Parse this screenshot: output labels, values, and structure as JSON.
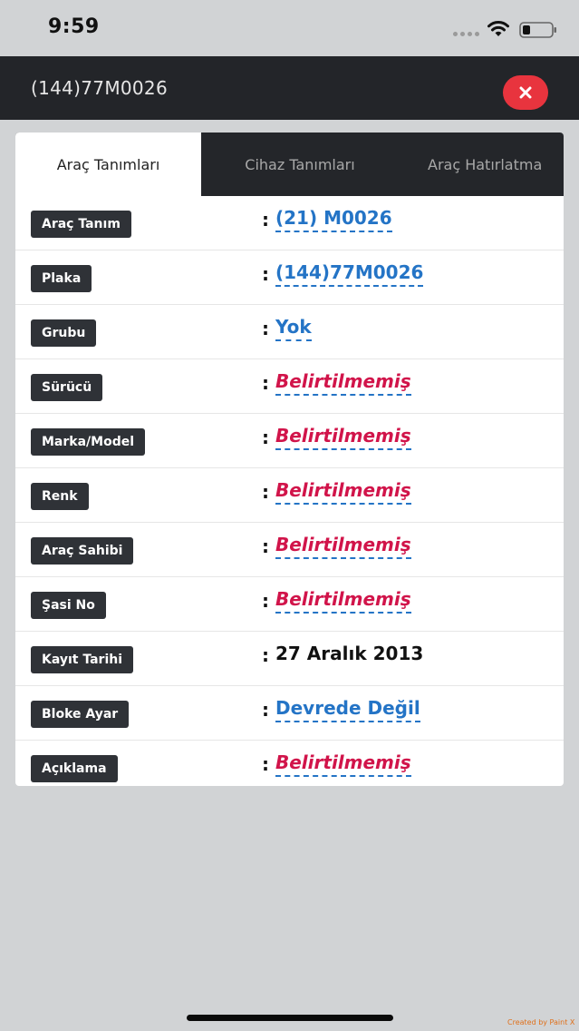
{
  "status_bar": {
    "time": "9:59"
  },
  "header": {
    "title": "(144)77M0026",
    "close_icon": "close-icon",
    "close_color": "#e8343e"
  },
  "tabs": [
    {
      "label": "Araç Tanımları",
      "active": true
    },
    {
      "label": "Cihaz Tanımları",
      "active": false
    },
    {
      "label": "Araç Hatırlatma",
      "active": false
    }
  ],
  "rows": [
    {
      "label": "Araç Tanım",
      "colon": ":",
      "value": "(21) M0026",
      "style": "link"
    },
    {
      "label": "Plaka",
      "colon": ":",
      "value": "(144)77M0026",
      "style": "link"
    },
    {
      "label": "Grubu",
      "colon": ":",
      "value": "Yok",
      "style": "link"
    },
    {
      "label": "Sürücü",
      "colon": ":",
      "value": "Belirtilmemiş",
      "style": "empty"
    },
    {
      "label": "Marka/Model",
      "colon": ":",
      "value": "Belirtilmemiş",
      "style": "empty"
    },
    {
      "label": "Renk",
      "colon": ":",
      "value": "Belirtilmemiş",
      "style": "empty"
    },
    {
      "label": "Araç Sahibi",
      "colon": ":",
      "value": "Belirtilmemiş",
      "style": "empty"
    },
    {
      "label": "Şasi No",
      "colon": ":",
      "value": "Belirtilmemiş",
      "style": "empty"
    },
    {
      "label": "Kayıt Tarihi",
      "colon": ":",
      "value": "27 Aralık 2013",
      "style": "plain"
    },
    {
      "label": "Bloke Ayar",
      "colon": ":",
      "value": "Devrede Değil",
      "style": "link"
    },
    {
      "label": "Açıklama",
      "colon": ":",
      "value": "Belirtilmemiş",
      "style": "empty"
    }
  ],
  "colors": {
    "link": "#2474c6",
    "empty": "#d1144a",
    "header_bg": "#232529",
    "page_bg": "#d1d3d5"
  },
  "watermark": "Created by Paint X"
}
